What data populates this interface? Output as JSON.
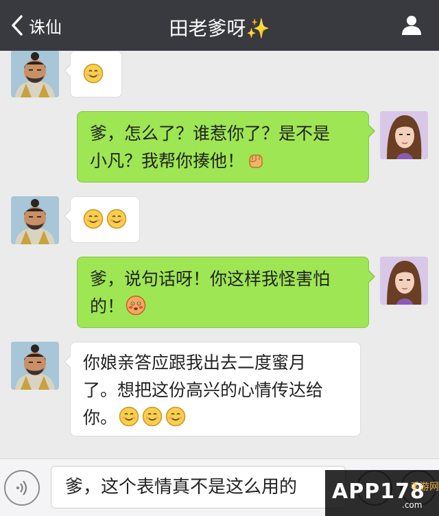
{
  "header": {
    "back_label": "诛仙",
    "title": "田老爹呀",
    "title_sparkle": "✨"
  },
  "messages": [
    {
      "side": "in",
      "sender": "田老爹",
      "text": "",
      "emoji": [
        "smile"
      ]
    },
    {
      "side": "out",
      "sender": "self",
      "text": "爹，怎么了？谁惹你了？是不是小凡？我帮你揍他！",
      "emoji": [
        "fist"
      ]
    },
    {
      "side": "in",
      "sender": "田老爹",
      "text": "",
      "emoji": [
        "smile",
        "smile"
      ]
    },
    {
      "side": "out",
      "sender": "self",
      "text": "爹，说句话呀！你这样我怪害怕的！",
      "emoji": [
        "blush"
      ]
    },
    {
      "side": "in",
      "sender": "田老爹",
      "text": "你娘亲答应跟我出去二度蜜月了。想把这份高兴的心情传达给你。",
      "emoji": [
        "smile",
        "smile",
        "smile"
      ]
    }
  ],
  "msg_lines": {
    "m2_l1": "爹，怎么了？谁惹你了？是不是",
    "m2_l2": "小凡？我帮你揍他！",
    "m4_l1": "爹，说句话呀！你这样我怪害怕",
    "m4_l2": "的！",
    "m5_l1": "你娘亲答应跟我出去二度蜜月",
    "m5_l2": "了。想把这份高兴的心情传达给",
    "m5_l3": "你。"
  },
  "input": {
    "value": "爹，这个表情真不是这么用的"
  },
  "watermark": {
    "logo": "APP178",
    "sub": "手游网",
    "domain": ".com"
  },
  "colors": {
    "nav_bg": "#393a3f",
    "chat_bg": "#ebebeb",
    "bubble_out": "#9ee653",
    "bubble_in": "#ffffff"
  }
}
